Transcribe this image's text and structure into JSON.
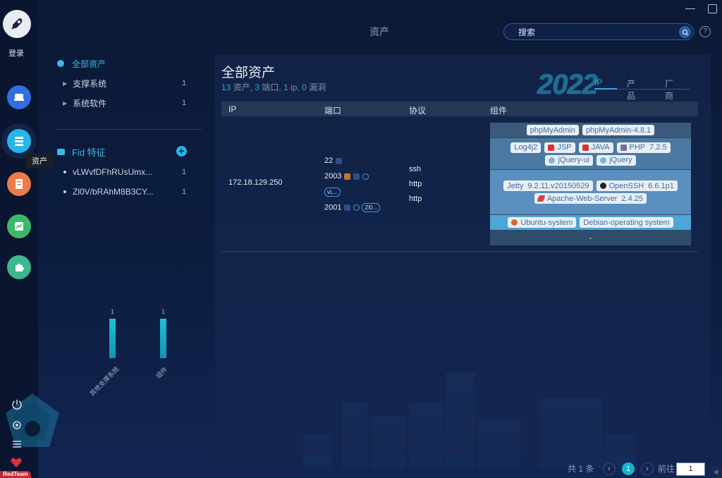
{
  "app": {
    "page_title": "资产",
    "login_label": "登录",
    "tooltip": "资产",
    "redteam_badge": "RedTeam"
  },
  "search": {
    "placeholder": "搜索"
  },
  "window": {
    "help": "?"
  },
  "sidebar": {
    "root": {
      "label": "全部资产"
    },
    "categories": [
      {
        "label": "支撑系统",
        "count": "1"
      },
      {
        "label": "系统软件",
        "count": "1"
      }
    ],
    "fid_title": "Fid 特征",
    "fid_items": [
      {
        "label": "vLWvfDFhRUsUmx...",
        "count": "1"
      },
      {
        "label": "Zl0V/bRAhM8B3CY...",
        "count": "1"
      }
    ],
    "mini_chart": {
      "bars": [
        {
          "label": "其他支撑系统",
          "value": "1"
        },
        {
          "label": "组件",
          "value": "1"
        }
      ]
    }
  },
  "main": {
    "title": "全部资产",
    "summary": {
      "assets_num": "13",
      "assets_lbl": " 资产, ",
      "ports_num": "3",
      "ports_lbl": " 端口, ",
      "ip_num": "1",
      "ip_lbl": " ip, ",
      "vuln_num": "0",
      "vuln_lbl": " 漏洞"
    },
    "year_badge": "2022",
    "tabs": [
      "IP",
      "产品",
      "厂商"
    ],
    "columns": [
      "IP",
      "端口",
      "协议",
      "组件"
    ],
    "row": {
      "ip": "172.18.129.250",
      "ports": [
        "22",
        "2003",
        "2001"
      ],
      "pills": [
        "vL...",
        "Zl0..."
      ],
      "protocols": [
        "ssh",
        "http",
        "http"
      ],
      "components": {
        "group1": [
          {
            "name": "phpMyAdmin"
          },
          {
            "name": "phpMyAdmin-4.8.1"
          }
        ],
        "group2": [
          {
            "name": "Log4j2"
          },
          {
            "name": "JSP",
            "icon": "java-icon"
          },
          {
            "name": "JAVA",
            "icon": "java-icon"
          },
          {
            "name": "PHP",
            "version": "7.2.5",
            "icon": "php-icon"
          },
          {
            "name": "jQuery-ui",
            "icon": "jquery-icon"
          },
          {
            "name": "jQuery",
            "icon": "jquery-icon"
          }
        ],
        "group3": [
          {
            "name": "Jetty",
            "version": "9.2.11.v20150529"
          },
          {
            "name": "OpenSSH",
            "version": "6.6.1p1",
            "icon": "openssh-icon"
          },
          {
            "name": "Apache-Web-Server",
            "version": "2.4.25",
            "icon": "apache-icon"
          }
        ],
        "group4": [
          {
            "name": "Ubuntu-system",
            "icon": "ubuntu-icon"
          },
          {
            "name": "Debian-operating system"
          }
        ],
        "group5": "-"
      }
    }
  },
  "pagination": {
    "total": "共 1 条",
    "current": "1",
    "goto_label": "前往",
    "goto_value": "1",
    "collapse": "«"
  }
}
